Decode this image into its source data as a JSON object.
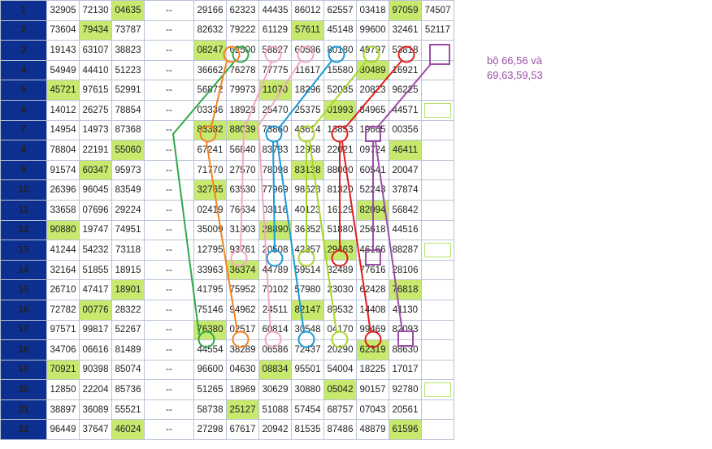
{
  "grid": {
    "rows": [
      {
        "day": "1",
        "cells": [
          "32905",
          "72130",
          "04635",
          "--",
          "29166",
          "62323",
          "44435",
          "86012",
          "62557",
          "03418",
          "97059",
          "74507"
        ],
        "hl": [
          2,
          10
        ]
      },
      {
        "day": "2",
        "cells": [
          "73604",
          "79434",
          "73787",
          "--",
          "82632",
          "79222",
          "61129",
          "57611",
          "45148",
          "99600",
          "32461",
          "52117"
        ],
        "hl": [
          1,
          7
        ]
      },
      {
        "day": "3",
        "cells": [
          "19143",
          "63107",
          "38823",
          "--",
          "08247",
          "62500",
          "58827",
          "60586",
          "80180",
          "49797",
          "53818",
          ""
        ],
        "hl": [
          4
        ]
      },
      {
        "day": "4",
        "cells": [
          "54949",
          "44410",
          "51223",
          "--",
          "36662",
          "76278",
          "77775",
          "11617",
          "15580",
          "30489",
          "16921",
          ""
        ],
        "hl": [
          9
        ]
      },
      {
        "day": "5",
        "cells": [
          "45721",
          "97615",
          "52991",
          "--",
          "56872",
          "79973",
          "11070",
          "18296",
          "52035",
          "20823",
          "96225",
          ""
        ],
        "hl": [
          0,
          6
        ]
      },
      {
        "day": "6",
        "cells": [
          "14012",
          "26275",
          "78854",
          "--",
          "03336",
          "18923",
          "25470",
          "25375",
          "01993",
          "84965",
          "44571",
          ""
        ],
        "hl": [
          8
        ]
      },
      {
        "day": "7",
        "cells": [
          "14954",
          "14973",
          "87368",
          "--",
          "83382",
          "88039",
          "73860",
          "43614",
          "13853",
          "19665",
          "00356",
          ""
        ],
        "hl": [
          4,
          5
        ]
      },
      {
        "day": "8",
        "cells": [
          "78804",
          "22191",
          "55060",
          "--",
          "67241",
          "56840",
          "83783",
          "12958",
          "22021",
          "09724",
          "46411",
          ""
        ],
        "hl": [
          2,
          10
        ]
      },
      {
        "day": "9",
        "cells": [
          "91574",
          "60347",
          "95973",
          "--",
          "71770",
          "27570",
          "78098",
          "83138",
          "88000",
          "60541",
          "20047",
          ""
        ],
        "hl": [
          1,
          7
        ]
      },
      {
        "day": "10",
        "cells": [
          "26396",
          "96045",
          "83549",
          "--",
          "32765",
          "63530",
          "77969",
          "98623",
          "81320",
          "52243",
          "37874",
          ""
        ],
        "hl": [
          4
        ]
      },
      {
        "day": "11",
        "cells": [
          "33658",
          "07696",
          "29224",
          "--",
          "02419",
          "76634",
          "03116",
          "40123",
          "16129",
          "82094",
          "56842",
          ""
        ],
        "hl": [
          9
        ]
      },
      {
        "day": "12",
        "cells": [
          "90880",
          "19747",
          "74951",
          "--",
          "35009",
          "31903",
          "28890",
          "36852",
          "51880",
          "25618",
          "44516",
          ""
        ],
        "hl": [
          0,
          6
        ]
      },
      {
        "day": "13",
        "cells": [
          "41244",
          "54232",
          "73118",
          "--",
          "12795",
          "93761",
          "20508",
          "42857",
          "29463",
          "46166",
          "88287",
          ""
        ],
        "hl": [
          8
        ]
      },
      {
        "day": "14",
        "cells": [
          "32164",
          "51855",
          "18915",
          "--",
          "33963",
          "36374",
          "44789",
          "59514",
          "32489",
          "77616",
          "28106",
          ""
        ],
        "hl": [
          5
        ]
      },
      {
        "day": "15",
        "cells": [
          "26710",
          "47417",
          "18901",
          "--",
          "41795",
          "75952",
          "70102",
          "57980",
          "23030",
          "62428",
          "76818",
          ""
        ],
        "hl": [
          2,
          10
        ]
      },
      {
        "day": "16",
        "cells": [
          "72782",
          "00776",
          "28322",
          "--",
          "75146",
          "94962",
          "24511",
          "82147",
          "89532",
          "14408",
          "41130",
          ""
        ],
        "hl": [
          1,
          7
        ]
      },
      {
        "day": "17",
        "cells": [
          "97571",
          "99817",
          "52267",
          "--",
          "76380",
          "02517",
          "60814",
          "30548",
          "04170",
          "99469",
          "82093",
          ""
        ],
        "hl": [
          4
        ]
      },
      {
        "day": "18",
        "cells": [
          "34706",
          "06616",
          "81489",
          "--",
          "44554",
          "38289",
          "06586",
          "72437",
          "20290",
          "62319",
          "88630",
          ""
        ],
        "hl": [
          9
        ]
      },
      {
        "day": "19",
        "cells": [
          "70921",
          "90398",
          "85074",
          "--",
          "96600",
          "04630",
          "08834",
          "95501",
          "54004",
          "18225",
          "17017",
          ""
        ],
        "hl": [
          0,
          6
        ]
      },
      {
        "day": "20",
        "cells": [
          "12850",
          "22204",
          "85736",
          "--",
          "51265",
          "18969",
          "30629",
          "30880",
          "05042",
          "90157",
          "92780",
          ""
        ],
        "hl": [
          8
        ]
      },
      {
        "day": "21",
        "cells": [
          "38897",
          "36089",
          "55521",
          "--",
          "58738",
          "25127",
          "51088",
          "57454",
          "68757",
          "07043",
          "20561",
          ""
        ],
        "hl": [
          5
        ]
      },
      {
        "day": "22",
        "cells": [
          "96449",
          "37647",
          "46024",
          "--",
          "27298",
          "67617",
          "20942",
          "81535",
          "87486",
          "48879",
          "61596",
          ""
        ],
        "hl": [
          2,
          10
        ]
      }
    ],
    "box_rows": [
      6,
      13,
      20
    ]
  },
  "note": {
    "line1": "bộ 66,56 và",
    "line2": "69,63,59,53",
    "color": "#9b4ea5"
  },
  "colors": {
    "header_bg": "#0d2f8f",
    "highlight": "#c6e96e",
    "green": "#2fa84a",
    "orange": "#f58220",
    "pink": "#f4a7c3",
    "blue": "#1a9ad9",
    "lime": "#a8d628",
    "red": "#e21d1d",
    "purple": "#9b4ea5"
  }
}
